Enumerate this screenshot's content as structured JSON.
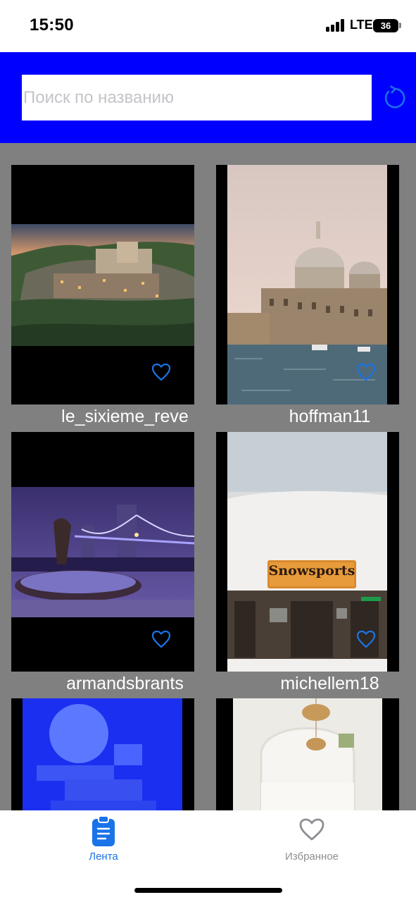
{
  "status_bar": {
    "time": "15:50",
    "network": "LTE",
    "battery": "36",
    "icons": [
      "signal-bars-icon",
      "battery-icon"
    ]
  },
  "search": {
    "placeholder": "Поиск по названию",
    "value": "",
    "refresh_icon": "refresh-icon"
  },
  "colors": {
    "header_bg": "#0000ff",
    "feed_bg": "#808080",
    "accent": "#1a73e8",
    "tab_inactive": "#8e8e93"
  },
  "feed": {
    "cards": [
      {
        "username": "le_sixieme_reve",
        "photo": "hillside village at dusk",
        "favorite_icon": "heart-outline-icon"
      },
      {
        "username": "hoffman11",
        "photo": "venice grand canal domes",
        "favorite_icon": "heart-outline-icon"
      },
      {
        "username": "armandsbrants",
        "photo": "tower bridge at night",
        "favorite_icon": "heart-outline-icon"
      },
      {
        "username": "michellem18",
        "photo": "snowsports cabin",
        "photo_sign": "Snowsports",
        "favorite_icon": "heart-outline-icon"
      },
      {
        "username": "",
        "photo": "blue geometric sphere"
      },
      {
        "username": "",
        "photo": "arched interior with pendant lamps"
      }
    ]
  },
  "tab_bar": {
    "tabs": [
      {
        "label": "Лента",
        "icon": "clipboard-list-icon",
        "active": true
      },
      {
        "label": "Избранное",
        "icon": "heart-icon",
        "active": false
      }
    ]
  }
}
